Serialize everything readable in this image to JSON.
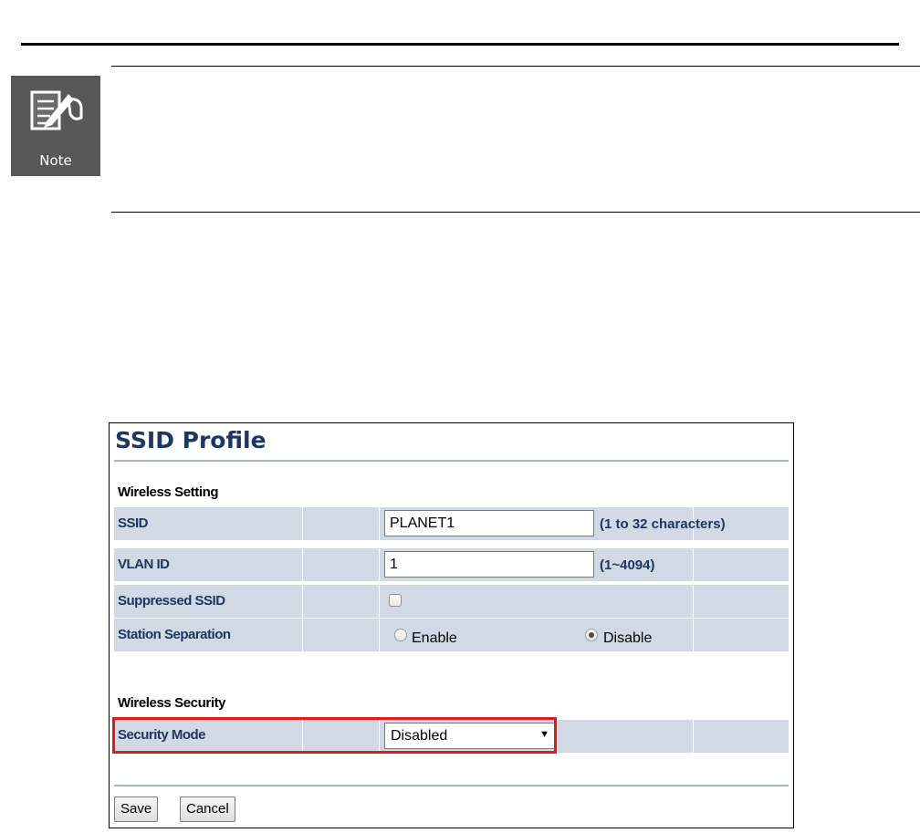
{
  "note": {
    "label": "Note"
  },
  "panel": {
    "title": "SSID Profile",
    "wireless_setting": {
      "heading": "Wireless Setting",
      "ssid": {
        "label": "SSID",
        "value": "PLANET1",
        "hint": "(1 to 32 characters)"
      },
      "vlan_id": {
        "label": "VLAN ID",
        "value": "1",
        "hint": "(1~4094)"
      },
      "suppressed_ssid": {
        "label": "Suppressed SSID",
        "checked": false
      },
      "station_separation": {
        "label": "Station Separation",
        "options": [
          {
            "label": "Enable",
            "selected": false
          },
          {
            "label": "Disable",
            "selected": true
          }
        ]
      }
    },
    "wireless_security": {
      "heading": "Wireless Security",
      "security_mode": {
        "label": "Security Mode",
        "selected": "Disabled"
      }
    },
    "buttons": {
      "save": "Save",
      "cancel": "Cancel"
    }
  },
  "colors": {
    "title_text": "#1c3761",
    "row_background": "#d1d9e5",
    "separator_rule": "#a9b5c8",
    "highlight": "#e01b1b",
    "note_icon_background": "#575757"
  }
}
